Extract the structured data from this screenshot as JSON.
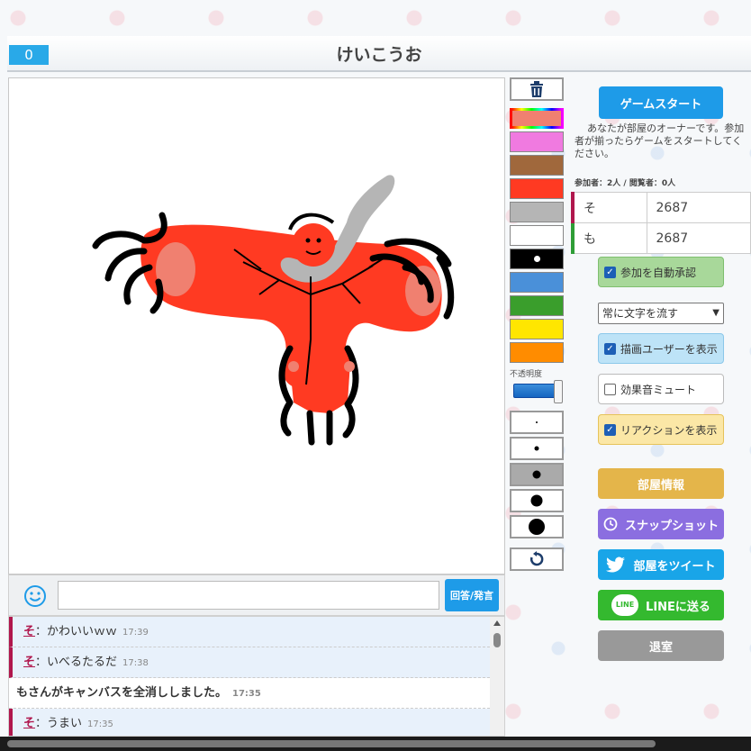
{
  "header": {
    "score": "0",
    "title": "けいこうお"
  },
  "tools": {
    "colors": [
      "#f08070",
      "#f07ae0",
      "#a0683c",
      "#ff3a22",
      "#b5b5b5",
      "#ffffff",
      "#000000",
      "#4a90d9",
      "#3a9e2c",
      "#ffe600",
      "#ff8c00"
    ],
    "selected_color_index": 0,
    "opacity_label": "不透明度",
    "opacity_level": 1.0,
    "brush_sizes": [
      2,
      5,
      9,
      13,
      18
    ],
    "selected_size_index": 2
  },
  "right": {
    "start_button": "ゲームスタート",
    "owner_note": "あなたが部屋のオーナーです。参加者が揃ったらゲームをスタートしてください。",
    "counts": "参加者：2人 / 閲覧者：0人",
    "players": [
      {
        "name": "そ",
        "score": "2687"
      },
      {
        "name": "も",
        "score": "2687"
      }
    ],
    "auto_approve": "参加を自動承認",
    "text_flow_select": "常に文字を流す",
    "show_drawer": "描画ユーザーを表示",
    "mute_sfx": "効果音ミュート",
    "show_reactions": "リアクションを表示",
    "room_info": "部屋情報",
    "snapshot": "スナップショット",
    "tweet": "部屋をツイート",
    "line": "LINEに送る",
    "line_logo": "LINE",
    "leave": "退室"
  },
  "chat": {
    "send_button": "回答/発言",
    "input_value": "",
    "messages": [
      {
        "type": "user",
        "who": "そ",
        "text": "：かわいいｗｗ",
        "time": "17:39"
      },
      {
        "type": "user",
        "who": "そ",
        "text": "：いべるたるだ",
        "time": "17:38"
      },
      {
        "type": "system",
        "who": "",
        "text": "もさんがキャンバスを全消ししました。",
        "time": "17:35"
      },
      {
        "type": "user",
        "who": "そ",
        "text": "：うまい",
        "time": "17:35"
      }
    ]
  },
  "colors": {
    "accent_blue": "#1e9be8",
    "room_info": "#e4b54a",
    "snapshot": "#8b6ee0",
    "tweet": "#19a5e8",
    "line": "#34b92f",
    "leave": "#999999",
    "green_option": "#a8d89a",
    "blue_option": "#bde3f7",
    "yellow_option": "#fbe7a6"
  }
}
